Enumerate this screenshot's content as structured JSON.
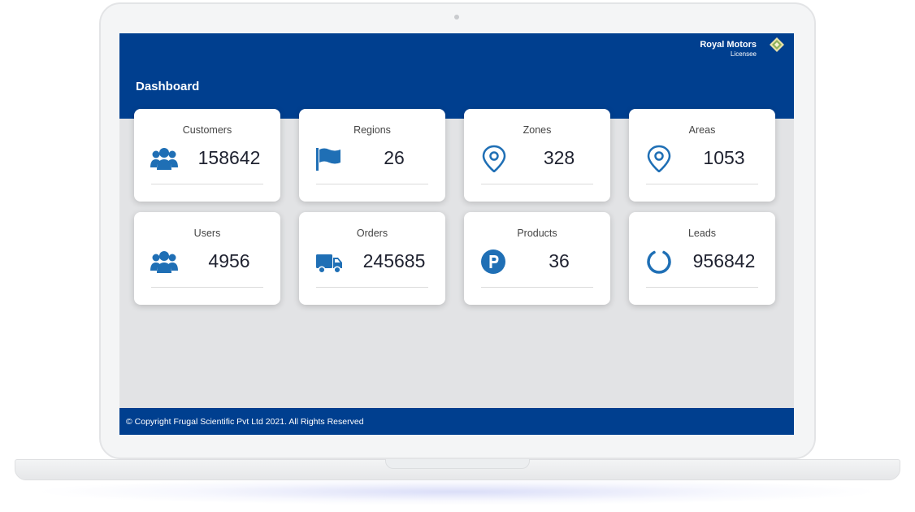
{
  "brand": {
    "name": "Royal Motors",
    "subtitle": "Licensee"
  },
  "page_title": "Dashboard",
  "colors": {
    "header": "#003f8f",
    "accent_icon": "#1f6fb5",
    "background": "#e2e3e5"
  },
  "cards": [
    {
      "title": "Customers",
      "value": "158642",
      "icon": "users-icon"
    },
    {
      "title": "Regions",
      "value": "26",
      "icon": "flag-icon"
    },
    {
      "title": "Zones",
      "value": "328",
      "icon": "map-pin-icon"
    },
    {
      "title": "Areas",
      "value": "1053",
      "icon": "map-pin-icon"
    },
    {
      "title": "Users",
      "value": "4956",
      "icon": "users-icon"
    },
    {
      "title": "Orders",
      "value": "245685",
      "icon": "truck-icon"
    },
    {
      "title": "Products",
      "value": "36",
      "icon": "parking-icon"
    },
    {
      "title": "Leads",
      "value": "956842",
      "icon": "circle-notch-icon"
    }
  ],
  "footer": {
    "text": "© Copyright Frugal Scientific Pvt Ltd 2021. All Rights Reserved"
  }
}
